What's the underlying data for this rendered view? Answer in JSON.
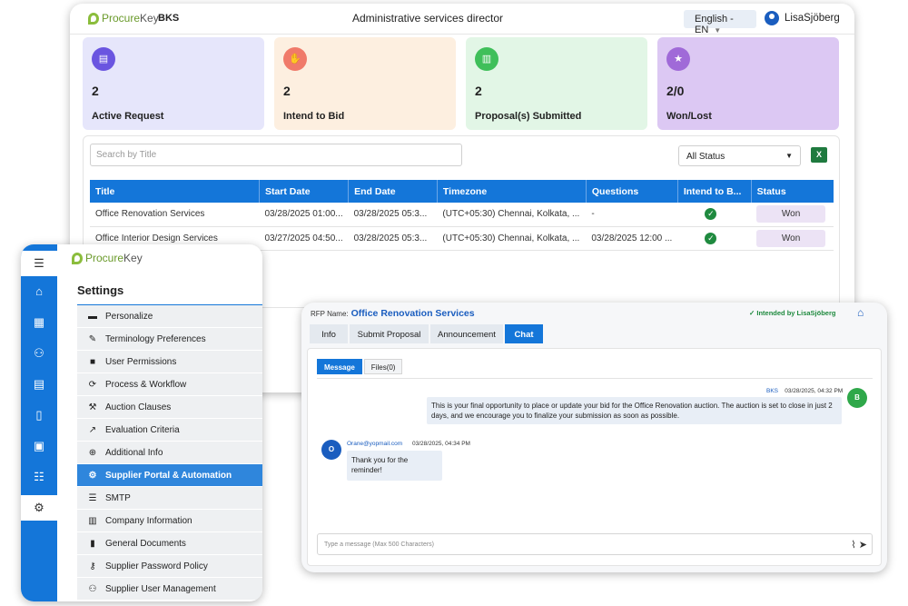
{
  "dashboard": {
    "brand": {
      "part1": "Procure",
      "part2": "Key"
    },
    "org": "BKS",
    "role": "Administrative services director",
    "language": "English - EN",
    "user": "LisaSjöberg",
    "cards": [
      {
        "value": "2",
        "label": "Active Request",
        "bg": "#e6e6fb",
        "icon_bg": "#6a55e0",
        "icon": "document-hand-icon"
      },
      {
        "value": "2",
        "label": "Intend to Bid",
        "bg": "#fdefe0",
        "icon_bg": "#f07a6a",
        "icon": "handshake-icon"
      },
      {
        "value": "2",
        "label": "Proposal(s) Submitted",
        "bg": "#e2f6e6",
        "icon_bg": "#3fbf5a",
        "icon": "clipboard-icon"
      },
      {
        "value": "2/0",
        "label": "Won/Lost",
        "bg": "#dcc8f3",
        "icon_bg": "#a06ad8",
        "icon": "trophy-icon"
      }
    ],
    "search_placeholder": "Search by Title",
    "status_filter": "All Status",
    "columns": [
      "Title",
      "Start Date",
      "End Date",
      "Timezone",
      "Questions",
      "Intend to B...",
      "Status"
    ],
    "rows": [
      {
        "title": "Office Renovation Services",
        "start": "03/28/2025 01:00...",
        "end": "03/28/2025 05:3...",
        "timezone": "(UTC+05:30) Chennai, Kolkata, ...",
        "questions": "-",
        "status": "Won"
      },
      {
        "title": "Office Interior Design Services",
        "start": "03/27/2025 04:50...",
        "end": "03/28/2025 05:3...",
        "timezone": "(UTC+05:30) Chennai, Kolkata, ...",
        "questions": "03/28/2025 12:00 ...",
        "status": "Won"
      }
    ]
  },
  "settings": {
    "brand": {
      "part1": "Procure",
      "part2": "Key"
    },
    "title": "Settings",
    "items": [
      {
        "label": "Personalize",
        "icon": "monitor-icon"
      },
      {
        "label": "Terminology Preferences",
        "icon": "pencil-icon"
      },
      {
        "label": "User Permissions",
        "icon": "lock-icon"
      },
      {
        "label": "Process & Workflow",
        "icon": "sync-icon"
      },
      {
        "label": "Auction Clauses",
        "icon": "gavel-icon"
      },
      {
        "label": "Evaluation Criteria",
        "icon": "chart-line-icon"
      },
      {
        "label": "Additional Info",
        "icon": "plus-circle-icon"
      },
      {
        "label": "Supplier Portal & Automation",
        "icon": "gear-icon"
      },
      {
        "label": "SMTP",
        "icon": "server-icon"
      },
      {
        "label": "Company Information",
        "icon": "building-icon"
      },
      {
        "label": "General Documents",
        "icon": "file-icon"
      },
      {
        "label": "Supplier Password Policy",
        "icon": "key-icon"
      },
      {
        "label": "Supplier User Management",
        "icon": "users-icon"
      }
    ],
    "selected_index": 7
  },
  "chat": {
    "rfp_label": "RFP Name:",
    "rfp_name": "Office Renovation Services",
    "intended": "Intended by LisaSjöberg",
    "tabs": [
      "Info",
      "Submit Proposal",
      "Announcement",
      "Chat"
    ],
    "subtabs": [
      "Message",
      "Files(0)"
    ],
    "messages": [
      {
        "sender": "BKS",
        "time": "03/28/2025, 04:32 PM",
        "avatar": "B",
        "text": "This is your final opportunity to place or update your bid for the Office Renovation auction. The auction is set to close in just 2 days, and we encourage you to finalize your submission as soon as possible."
      },
      {
        "sender": "Orane@yopmail.com",
        "time": "03/28/2025, 04:34 PM",
        "avatar": "O",
        "text": "Thank you for the reminder!"
      }
    ],
    "input_placeholder": "Type a message (Max 500 Characters)"
  }
}
